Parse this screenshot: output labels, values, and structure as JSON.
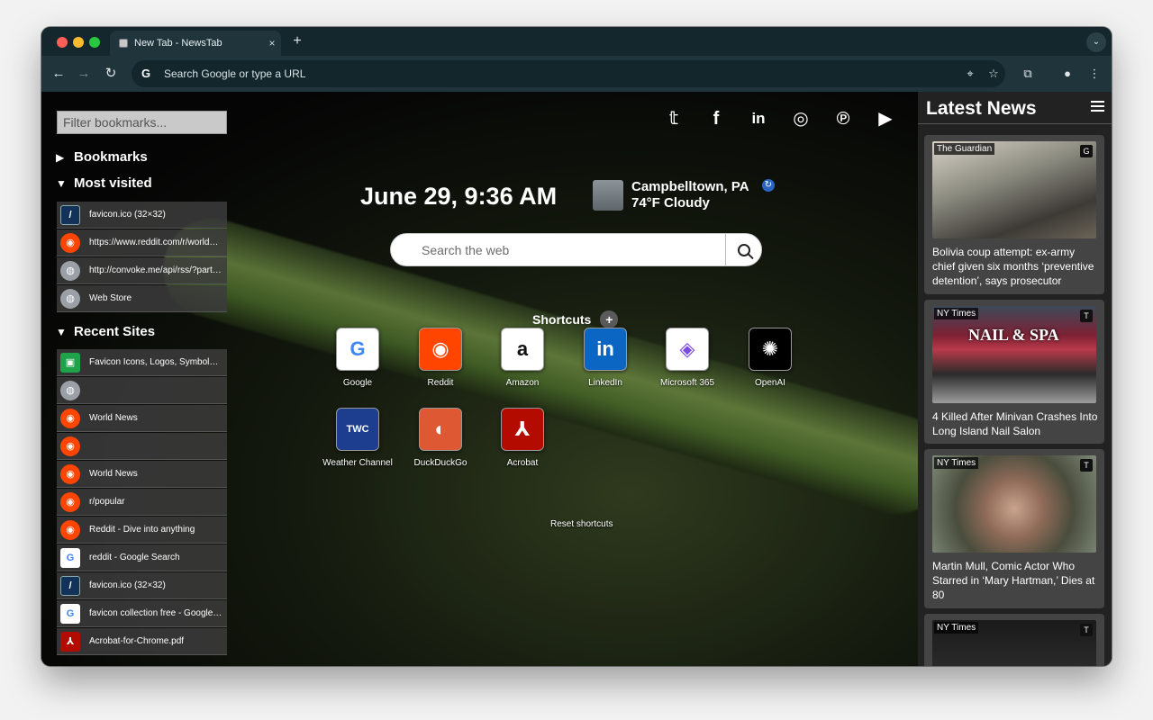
{
  "browser": {
    "tab_title": "New Tab - NewsTab",
    "tab_close": "×",
    "new_tab": "+",
    "omnibox_placeholder": "Search Google or type a URL"
  },
  "bookmarks": {
    "filter_placeholder": "Filter bookmarks...",
    "sections": {
      "bookmarks": "Bookmarks",
      "most_visited": "Most visited",
      "recent_sites": "Recent Sites"
    },
    "most_visited": [
      {
        "label": "favicon.ico (32×32)",
        "icon": "favicon-ico-icon"
      },
      {
        "label": "https://www.reddit.com/r/worldnews/",
        "icon": "reddit-icon"
      },
      {
        "label": "http://convoke.me/api/rss/?partner=",
        "icon": "globe-icon"
      },
      {
        "label": "Web Store",
        "icon": "globe-icon"
      }
    ],
    "recent_sites": [
      {
        "label": "Favicon Icons, Logos, Symbols - Free",
        "icon": "favicon-green-icon"
      },
      {
        "label": "",
        "icon": "globe-icon"
      },
      {
        "label": "World News",
        "icon": "reddit-icon"
      },
      {
        "label": "",
        "icon": "reddit-icon"
      },
      {
        "label": "World News",
        "icon": "reddit-icon"
      },
      {
        "label": "r/popular",
        "icon": "reddit-icon"
      },
      {
        "label": "Reddit - Dive into anything",
        "icon": "reddit-icon"
      },
      {
        "label": "reddit - Google Search",
        "icon": "google-icon"
      },
      {
        "label": "favicon.ico (32×32)",
        "icon": "favicon-ico-icon"
      },
      {
        "label": "favicon collection free - Google Search",
        "icon": "google-icon"
      },
      {
        "label": "Acrobat-for-Chrome.pdf",
        "icon": "adobe-icon"
      }
    ]
  },
  "social": [
    "twitter-icon",
    "facebook-icon",
    "linkedin-icon",
    "instagram-icon",
    "pinterest-icon",
    "youtube-icon"
  ],
  "datetime": "June 29, 9:36 AM",
  "weather": {
    "city": "Campbelltown, PA",
    "conditions": "74°F Cloudy"
  },
  "search": {
    "placeholder": "Search the web"
  },
  "shortcuts": {
    "title": "Shortcuts",
    "reset_label": "Reset shortcuts",
    "items": [
      {
        "label": "Google",
        "glyph": "G",
        "color": "#4285f4",
        "bg": "#ffffff"
      },
      {
        "label": "Reddit",
        "glyph": "◉",
        "color": "#ffffff",
        "bg": "#ff4500"
      },
      {
        "label": "Amazon",
        "glyph": "a",
        "color": "#111111",
        "bg": "#ffffff"
      },
      {
        "label": "LinkedIn",
        "glyph": "in",
        "color": "#ffffff",
        "bg": "#0a66c2"
      },
      {
        "label": "Microsoft 365",
        "glyph": "◈",
        "color": "#7b4ce0",
        "bg": "#ffffff"
      },
      {
        "label": "OpenAI",
        "glyph": "✺",
        "color": "#ffffff",
        "bg": "#000000"
      },
      {
        "label": "Weather Channel",
        "glyph": "TWC",
        "color": "#ffffff",
        "bg": "#1d3d8f"
      },
      {
        "label": "DuckDuckGo",
        "glyph": "◐",
        "color": "#ffffff",
        "bg": "#de5833"
      },
      {
        "label": "Acrobat",
        "glyph": "⅄",
        "color": "#ffffff",
        "bg": "#b30b00"
      }
    ]
  },
  "news": {
    "title": "Latest News",
    "items": [
      {
        "source": "The Guardian",
        "headline": "Bolivia coup attempt: ex-army chief given six months ‘preventive detention’, says prosecutor"
      },
      {
        "source": "NY Times",
        "headline": "4 Killed After Minivan Crashes Into Long Island Nail Salon",
        "sign": "NAIL & SPA"
      },
      {
        "source": "NY Times",
        "headline": "Martin Mull, Comic Actor Who Starred in ‘Mary Hartman,’ Dies at 80"
      },
      {
        "source": "NY Times",
        "headline": ""
      }
    ]
  }
}
